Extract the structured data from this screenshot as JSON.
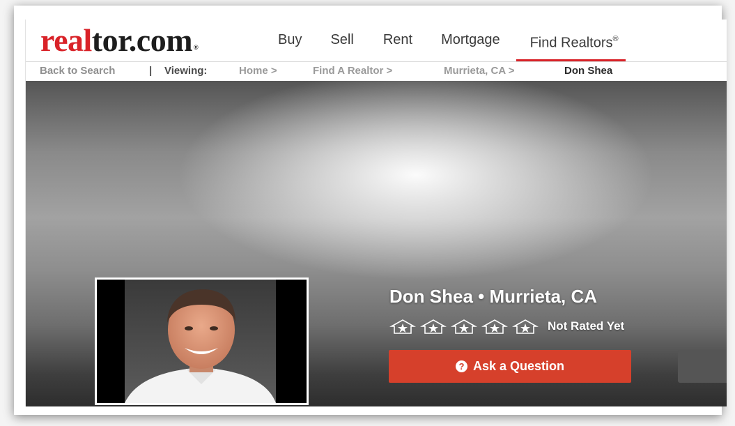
{
  "header": {
    "logo": {
      "part1": "real",
      "part2": "tor.com",
      "mark": "®"
    },
    "nav": [
      {
        "label": "Buy"
      },
      {
        "label": "Sell"
      },
      {
        "label": "Rent"
      },
      {
        "label": "Mortgage"
      },
      {
        "label": "Find Realtors",
        "suffix": "®",
        "active": true
      }
    ]
  },
  "breadcrumb": {
    "back": "Back to Search",
    "separator": "|",
    "viewing": "Viewing:",
    "items": [
      "Home >",
      "Find A Realtor >",
      "Murrieta, CA >"
    ],
    "current": "Don Shea"
  },
  "profile": {
    "title": "Don Shea • Murrieta, CA",
    "rating_text": "Not Rated Yet",
    "stars_total": 5,
    "stars_filled": 0,
    "ask_button": "Ask a Question",
    "ask_icon": "question-circle-icon"
  },
  "colors": {
    "brand_red": "#d92228",
    "button_red": "#d6402b"
  }
}
